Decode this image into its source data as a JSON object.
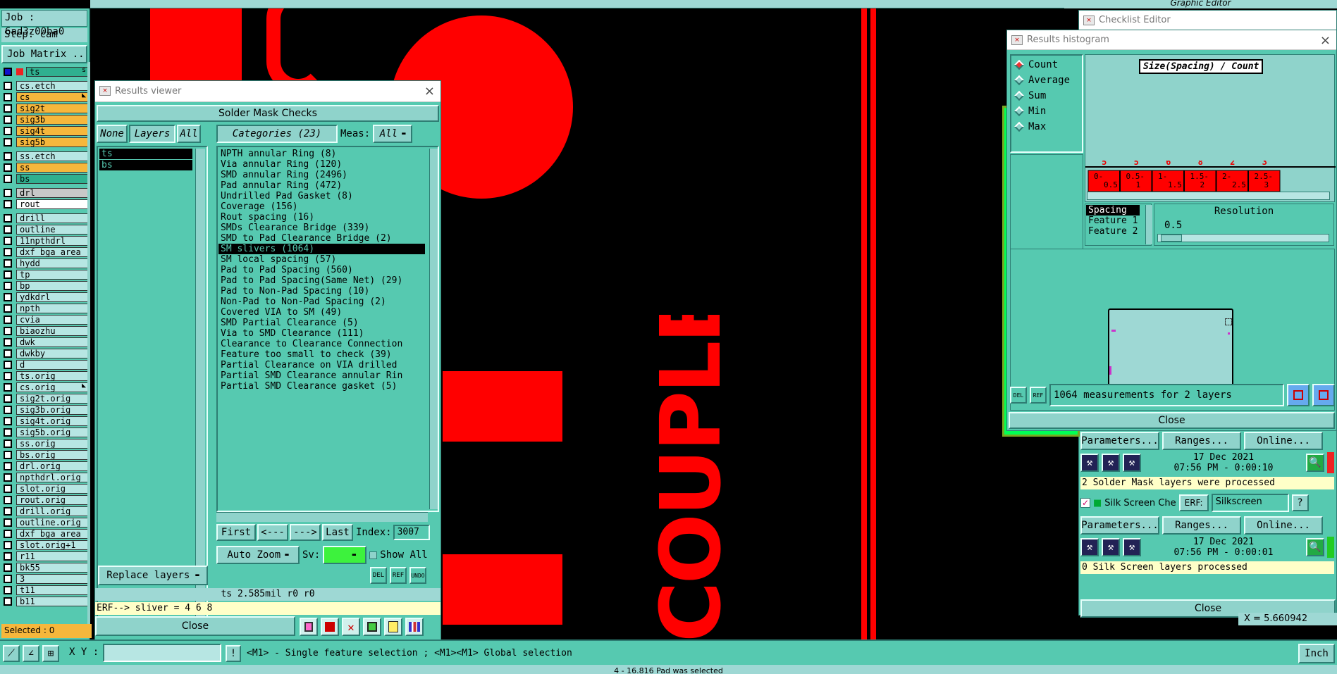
{
  "job": {
    "job_label": "Job : 6ad3z00ba0",
    "step_label": "Step: cam",
    "matrix_btn": "Job Matrix ..."
  },
  "layers": [
    {
      "name": "ts",
      "style": "g",
      "flag": "s"
    },
    {
      "name": "cs.etch",
      "style": ""
    },
    {
      "name": "cs",
      "style": "y",
      "flag": "◣"
    },
    {
      "name": "sig2t",
      "style": "y"
    },
    {
      "name": "sig3b",
      "style": "y"
    },
    {
      "name": "sig4t",
      "style": "y"
    },
    {
      "name": "sig5b",
      "style": "y"
    },
    {
      "name": "ss.etch",
      "style": ""
    },
    {
      "name": "ss",
      "style": "y"
    },
    {
      "name": "bs",
      "style": "g"
    },
    {
      "name": "drl",
      "style": "gr"
    },
    {
      "name": "rout",
      "style": "w"
    },
    {
      "name": "drill",
      "style": ""
    },
    {
      "name": "outline",
      "style": ""
    },
    {
      "name": "11npthdrl",
      "style": ""
    },
    {
      "name": "dxf_bga_area",
      "style": ""
    },
    {
      "name": "hydd",
      "style": ""
    },
    {
      "name": "tp",
      "style": ""
    },
    {
      "name": "bp",
      "style": ""
    },
    {
      "name": "ydkdrl",
      "style": ""
    },
    {
      "name": "npth",
      "style": ""
    },
    {
      "name": "cvia",
      "style": ""
    },
    {
      "name": "biaozhu",
      "style": ""
    },
    {
      "name": "dwk",
      "style": ""
    },
    {
      "name": "dwkby",
      "style": ""
    },
    {
      "name": "d",
      "style": ""
    },
    {
      "name": "ts.orig",
      "style": ""
    },
    {
      "name": "cs.orig",
      "style": "",
      "flag": "◣"
    },
    {
      "name": "sig2t.orig",
      "style": ""
    },
    {
      "name": "sig3b.orig",
      "style": ""
    },
    {
      "name": "sig4t.orig",
      "style": ""
    },
    {
      "name": "sig5b.orig",
      "style": ""
    },
    {
      "name": "ss.orig",
      "style": ""
    },
    {
      "name": "bs.orig",
      "style": ""
    },
    {
      "name": "drl.orig",
      "style": ""
    },
    {
      "name": "npthdrl.orig",
      "style": ""
    },
    {
      "name": "slot.orig",
      "style": ""
    },
    {
      "name": "rout.orig",
      "style": ""
    },
    {
      "name": "drill.orig",
      "style": ""
    },
    {
      "name": "outline.orig",
      "style": ""
    },
    {
      "name": "dxf_bga_area",
      "style": ""
    },
    {
      "name": "slot.orig+1",
      "style": ""
    },
    {
      "name": "r11",
      "style": ""
    },
    {
      "name": "bk55",
      "style": ""
    },
    {
      "name": "3",
      "style": ""
    },
    {
      "name": "t11",
      "style": ""
    },
    {
      "name": "b11",
      "style": ""
    }
  ],
  "selected": "Selected : 0",
  "results_viewer": {
    "title": "Results viewer",
    "header": "Solder Mask Checks",
    "none_btn": "None",
    "layers_btn": "Layers",
    "all_btn": "All",
    "categories_btn": "Categories (23)",
    "meas_label": "Meas:",
    "meas_value": "All",
    "layer_items": [
      "ts",
      "bs"
    ],
    "categories": [
      "NPTH annular Ring (8)",
      "Via annular Ring (120)",
      "SMD annular Ring (2496)",
      "Pad annular Ring (472)",
      "Undrilled Pad Gasket (8)",
      "Coverage (156)",
      "Rout spacing (16)",
      "SMDs Clearance Bridge (339)",
      "SMD to Pad Clearance Bridge (2)",
      "SM slivers (1064)",
      "SM local spacing (57)",
      "Pad to Pad Spacing (560)",
      "Pad to Pad Spacing(Same Net) (29)",
      "Pad to Non-Pad Spacing (10)",
      "Non-Pad to Non-Pad Spacing (2)",
      "Covered VIA to SM (49)",
      "SMD Partial Clearance (5)",
      "Via to SMD Clearance (111)",
      "Clearance to Clearance Connection",
      "Feature too small to check (39)",
      "Partial Clearance on VIA drilled",
      "Partial SMD Clearance annular Rin",
      "Partial SMD Clearance gasket (5)"
    ],
    "selected_category": 9,
    "first": "First",
    "prev": "<---",
    "next": "--->",
    "last": "Last",
    "index_label": "Index:",
    "index_value": "3007",
    "auto_zoom": "Auto Zoom",
    "sv_label": "Sv:",
    "show_all": "Show All",
    "replace_layers": "Replace layers",
    "del": "DEL",
    "ref": "REF",
    "undo": "UNDO",
    "status": "ts 2.585mil  r0  r0",
    "erf_line": "ERF--> sliver = 4 6 8",
    "close": "Close"
  },
  "histogram": {
    "title": "Results histogram",
    "modes": [
      "Count",
      "Average",
      "Sum",
      "Min",
      "Max"
    ],
    "active_mode": "Count",
    "chart_title": "Size(Spacing) / Count",
    "counts": [
      "5",
      "5",
      "6",
      "8",
      "2",
      "3"
    ],
    "bins": [
      "0-\n0.5",
      "0.5-\n1",
      "1-\n1.5",
      "1.5-\n2",
      "2-\n2.5",
      "2.5-\n3"
    ],
    "list": [
      "Spacing",
      "Feature 1",
      "Feature 2"
    ],
    "resolution_label": "Resolution",
    "resolution_value": "0.5",
    "measurements": "1064 measurements for 2 layers",
    "close": "Close"
  },
  "checklist": {
    "title": "Checklist Editor",
    "params": "Parameters...",
    "ranges": "Ranges...",
    "online": "Online...",
    "date1": "17 Dec 2021",
    "time1": "07:56 PM - 0:00:10",
    "msg1": "2 Solder Mask layers were processed",
    "silk_label": "Silk Screen Che",
    "erf_label": "ERF:",
    "erf_value": "Silkscreen",
    "date2": "17 Dec 2021",
    "time2": "07:56 PM - 0:00:01",
    "msg2": "0 Silk Screen layers processed",
    "close": "Close"
  },
  "graphic_editor_title": "Graphic Editor",
  "bottom": {
    "xy_label": "X Y :",
    "hint": "<M1> - Single feature selection ; <M1><M1> Global selection",
    "units": "Inch",
    "coord": "X = 5.660942",
    "status": "4 - 16.816 Pad was selected"
  },
  "canvas_text": "COUPLE"
}
